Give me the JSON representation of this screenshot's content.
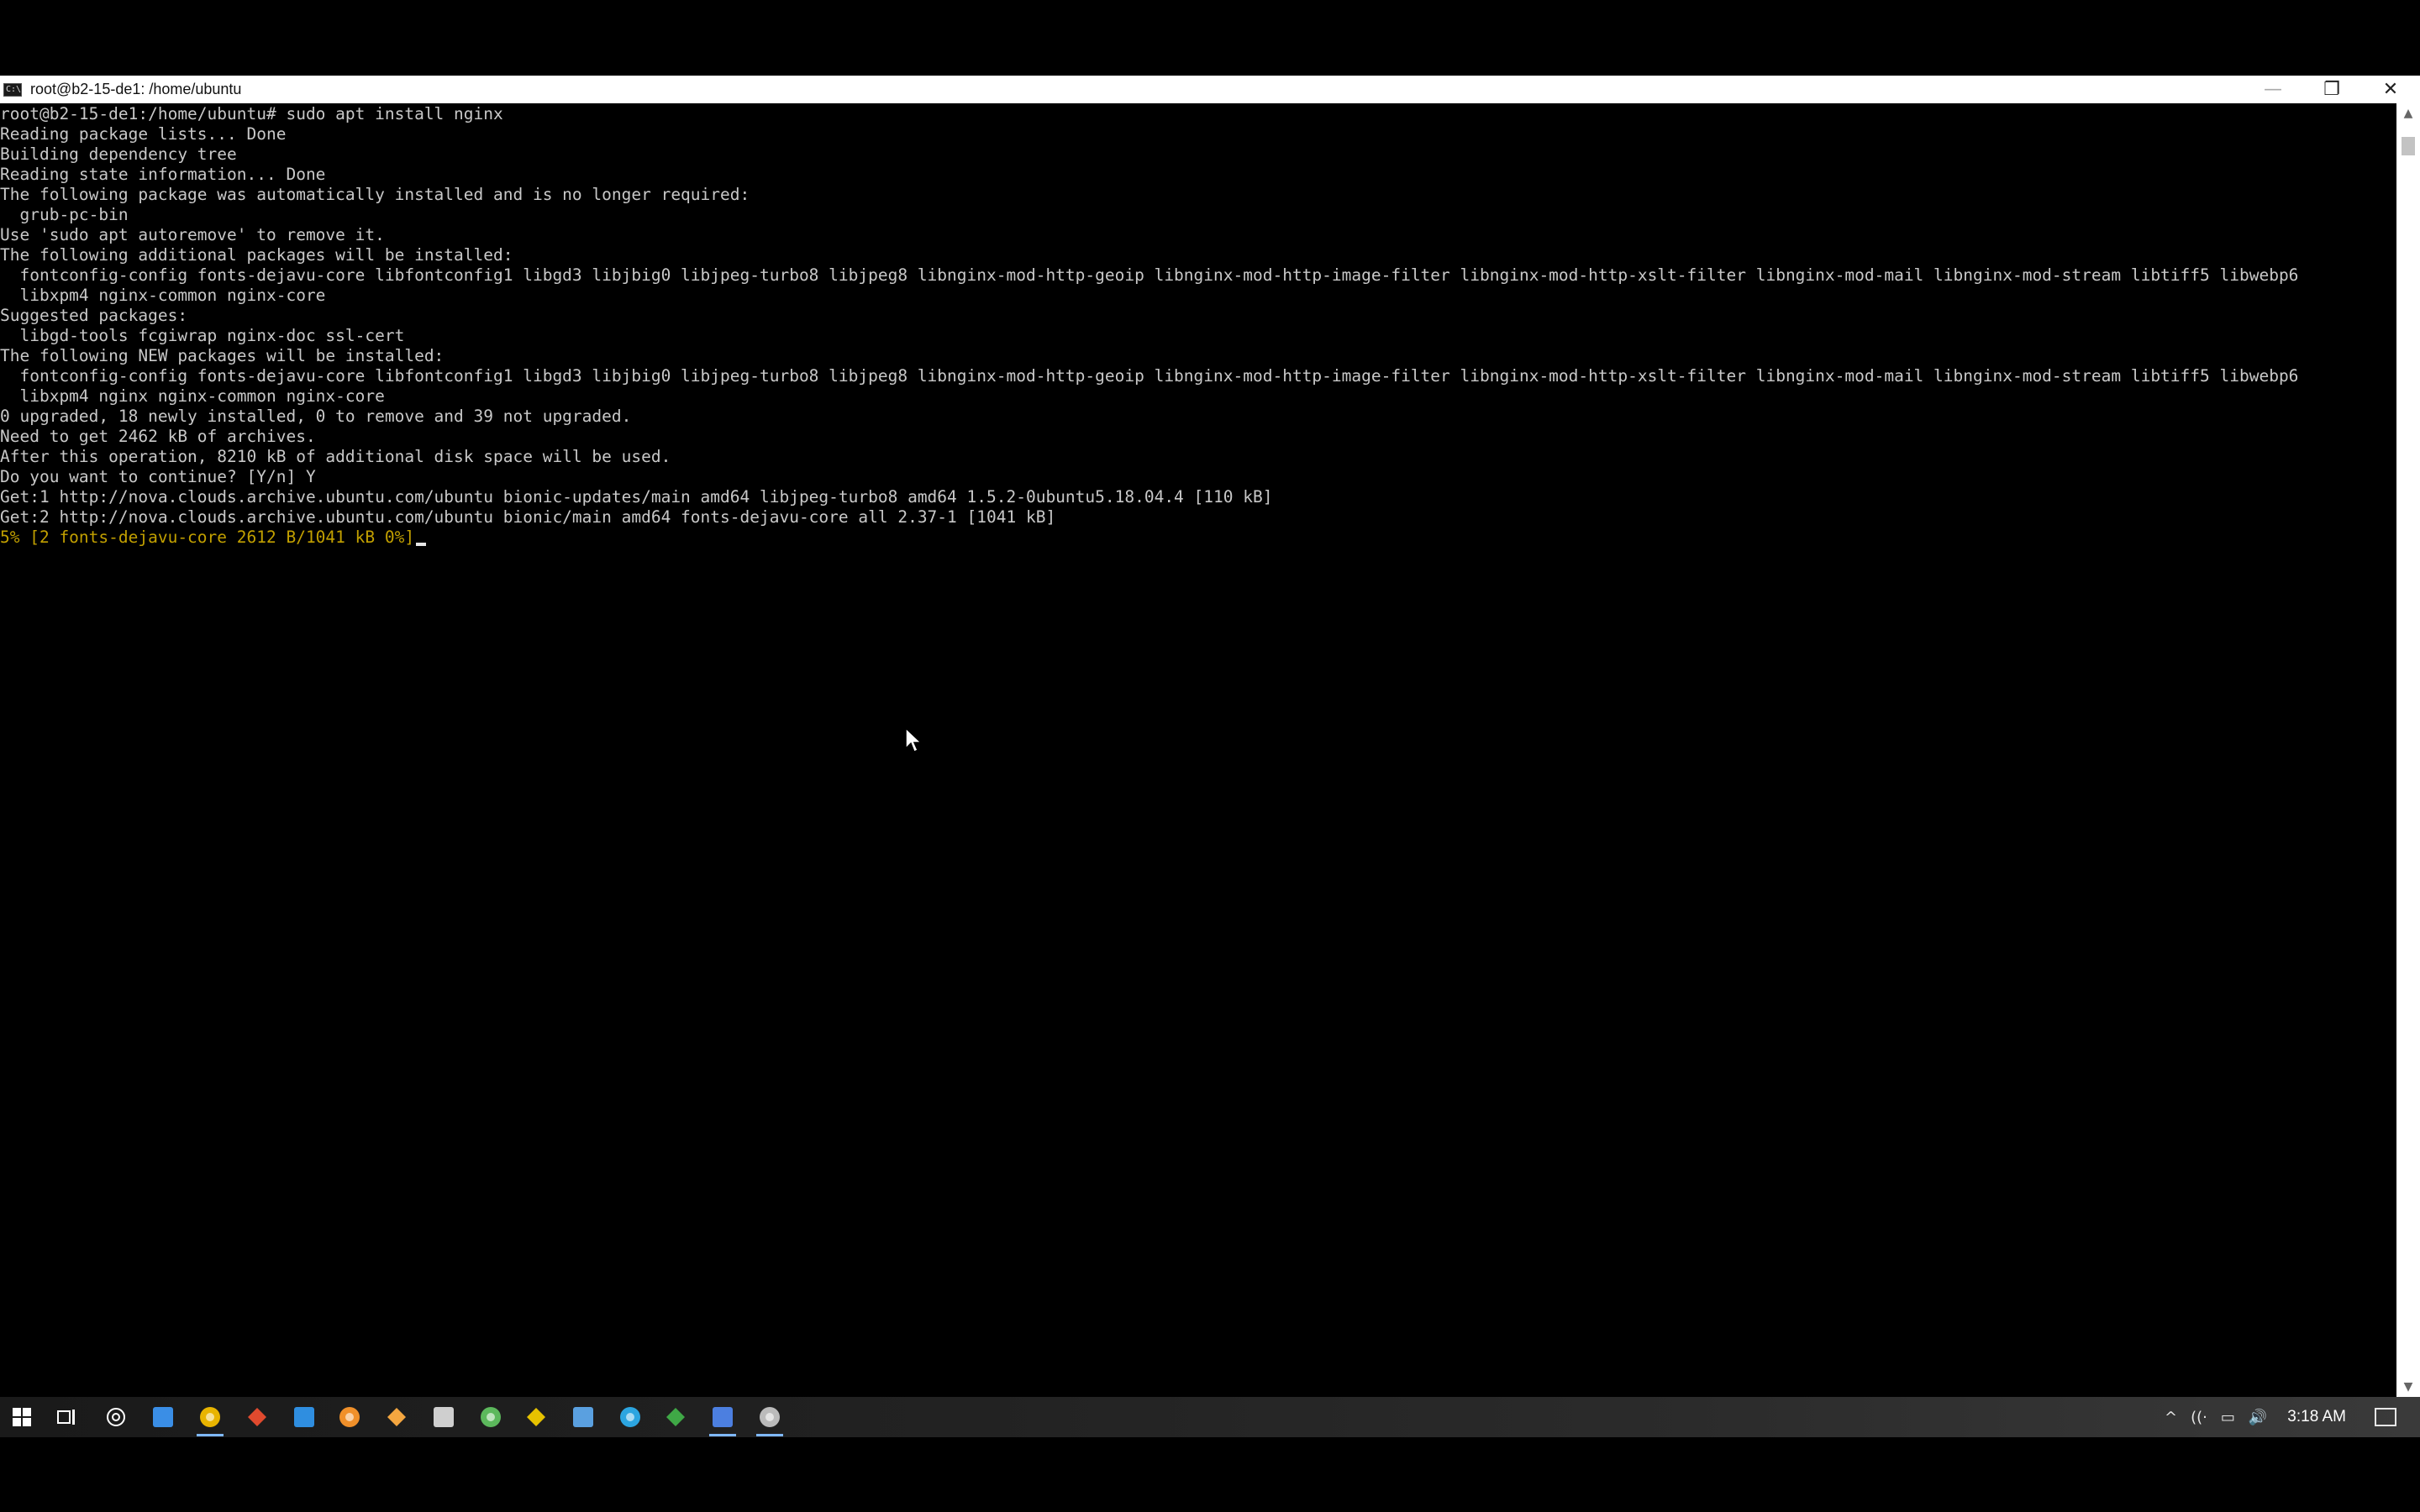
{
  "window": {
    "title": "root@b2-15-de1: /home/ubuntu",
    "icon": "console-icon",
    "icon_glyph": "C:\\",
    "minimize": "—",
    "restore": "❐",
    "close": "✕"
  },
  "terminal": {
    "lines": [
      "root@b2-15-de1:/home/ubuntu# sudo apt install nginx",
      "Reading package lists... Done",
      "Building dependency tree",
      "Reading state information... Done",
      "The following package was automatically installed and is no longer required:",
      "  grub-pc-bin",
      "Use 'sudo apt autoremove' to remove it.",
      "The following additional packages will be installed:",
      "  fontconfig-config fonts-dejavu-core libfontconfig1 libgd3 libjbig0 libjpeg-turbo8 libjpeg8 libnginx-mod-http-geoip libnginx-mod-http-image-filter libnginx-mod-http-xslt-filter libnginx-mod-mail libnginx-mod-stream libtiff5 libwebp6",
      "  libxpm4 nginx-common nginx-core",
      "Suggested packages:",
      "  libgd-tools fcgiwrap nginx-doc ssl-cert",
      "The following NEW packages will be installed:",
      "  fontconfig-config fonts-dejavu-core libfontconfig1 libgd3 libjbig0 libjpeg-turbo8 libjpeg8 libnginx-mod-http-geoip libnginx-mod-http-image-filter libnginx-mod-http-xslt-filter libnginx-mod-mail libnginx-mod-stream libtiff5 libwebp6",
      "  libxpm4 nginx nginx-common nginx-core",
      "0 upgraded, 18 newly installed, 0 to remove and 39 not upgraded.",
      "Need to get 2462 kB of archives.",
      "After this operation, 8210 kB of additional disk space will be used.",
      "Do you want to continue? [Y/n] Y",
      "Get:1 http://nova.clouds.archive.ubuntu.com/ubuntu bionic-updates/main amd64 libjpeg-turbo8 amd64 1.5.2-0ubuntu5.18.04.4 [110 kB]",
      "Get:2 http://nova.clouds.archive.ubuntu.com/ubuntu bionic/main amd64 fonts-dejavu-core all 2.37-1 [1041 kB]"
    ],
    "progress_line": "5% [2 fonts-dejavu-core 2612 B/1041 kB 0%]"
  },
  "scrollbar": {
    "up": "▲",
    "down": "▼"
  },
  "taskbar": {
    "items": [
      {
        "name": "start-icon",
        "color": "#ffffff"
      },
      {
        "name": "task-view-icon",
        "color": "#ffffff"
      },
      {
        "name": "cortana-icon",
        "color": "#ffffff"
      },
      {
        "name": "notes-app-icon",
        "color": "#3a8ee6"
      },
      {
        "name": "chrome-icon",
        "color": "#e8b400"
      },
      {
        "name": "red-circle-app-icon",
        "color": "#e04a2e"
      },
      {
        "name": "vscode-icon",
        "color": "#2f8ee0"
      },
      {
        "name": "orange-square-app-icon",
        "color": "#f0902a"
      },
      {
        "name": "orange-circle-app-icon",
        "color": "#f4a640"
      },
      {
        "name": "music-note-app-icon",
        "color": "#cfcfcf"
      },
      {
        "name": "green-circle-app-icon",
        "color": "#5cb85c"
      },
      {
        "name": "yellow-app-icon",
        "color": "#e6c200"
      },
      {
        "name": "window-app-icon",
        "color": "#5aa0e0"
      },
      {
        "name": "telegram-icon",
        "color": "#2ca5e0"
      },
      {
        "name": "spreadsheet-app-icon",
        "color": "#3fa846"
      },
      {
        "name": "blue-window-app-icon",
        "color": "#4c7fe0"
      },
      {
        "name": "console-app-icon",
        "color": "#bbbbbb"
      }
    ],
    "tray": {
      "chevron": "^",
      "wifi": "((·",
      "battery": "▭",
      "volume": "🔊",
      "clock": "3:18 AM"
    }
  }
}
